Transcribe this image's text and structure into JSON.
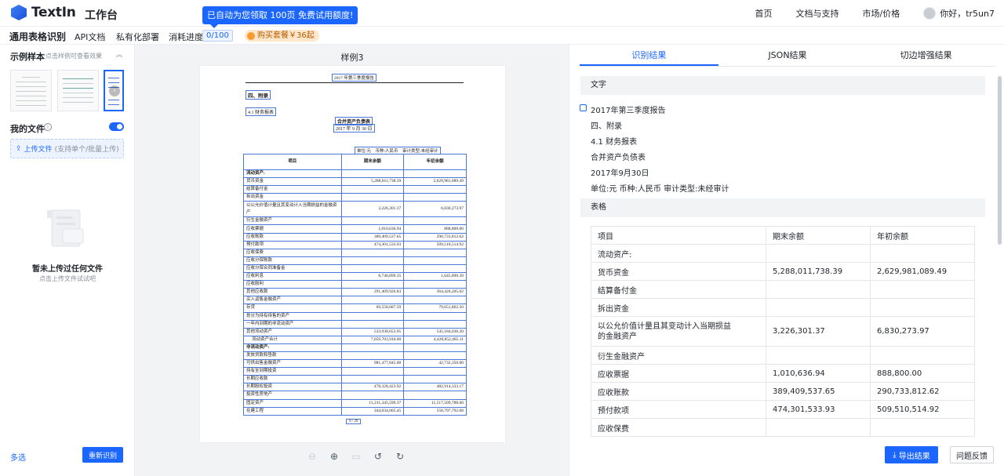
{
  "header": {
    "logo_text": "TextIn",
    "workbench": "工作台",
    "banner": "已自动为您领取 100页 免费试用额度!",
    "nav": [
      "首页",
      "文档与支持",
      "市场/价格"
    ],
    "greeting": "你好，tr5un7"
  },
  "subbar": {
    "title": "通用表格识别",
    "api_docs": "API文档",
    "private_deploy": "私有化部署",
    "usage_label": "消耗进度",
    "usage_value": "0/100",
    "buy_label": "购买套餐￥36起"
  },
  "left": {
    "samples_title": "示例样本",
    "samples_hint": "*点击样例可查看效果",
    "my_files": "我的文件",
    "upload_label": "上传文件",
    "upload_hint": "(支持单个/批量上传)",
    "empty_title": "暂未上传过任何文件",
    "empty_sub": "点击上传文件试试吧",
    "multi_select": "多选",
    "re_recognize": "重新识别"
  },
  "center": {
    "sample_name": "样例3",
    "doc": {
      "report_title": "2017 年第三季度报告",
      "section": "四、附录",
      "subsection": "4.1 财务报表",
      "table_title": "合并资产负债表",
      "date": "2017 年 9 月 30 日",
      "unit_line": "单位:元　币种:人民币　审计类型:未经审计",
      "page_number": "9 / 20",
      "table_header": [
        "项目",
        "期末余额",
        "年初余额"
      ],
      "rows": [
        [
          "流动资产:",
          "",
          ""
        ],
        [
          "货币资金",
          "5,288,011,738.39",
          "2,629,981,089.49"
        ],
        [
          "结算备付金",
          "",
          ""
        ],
        [
          "拆出资金",
          "",
          ""
        ],
        [
          "以公允价值计量且其变动计入当期损益的金融资产",
          "3,226,301.37",
          "6,830,273.97"
        ],
        [
          "衍生金融资产",
          "",
          ""
        ],
        [
          "应收票据",
          "1,010,636.94",
          "888,800.00"
        ],
        [
          "应收账款",
          "389,409,537.65",
          "290,733,812.62"
        ],
        [
          "预付款项",
          "474,301,533.93",
          "509,510,514.92"
        ],
        [
          "应收保费",
          "",
          ""
        ],
        [
          "应收分保账款",
          "",
          ""
        ],
        [
          "应收分保合同准备金",
          "",
          ""
        ],
        [
          "应收利息",
          "8,746,899.35",
          "1,645,890.39"
        ],
        [
          "应收股利",
          "",
          ""
        ],
        [
          "其他应收款",
          "291,409,926.83",
          "364,426,205.02"
        ],
        [
          "买入返售金融资产",
          "",
          ""
        ],
        [
          "存货",
          "69,558,687.59",
          "79,651,862.50"
        ],
        [
          "划分为持有待售的资产",
          "",
          ""
        ],
        [
          "一年内到期的非流动资产",
          "",
          ""
        ],
        [
          "其他流动资产",
          "533,938,653.95",
          "545,184,036.20"
        ],
        [
          "流动资产合计",
          "7,059,703,916.00",
          "4,428,852,485.11"
        ],
        [
          "非流动资产:",
          "",
          ""
        ],
        [
          "发放贷款和垫款",
          "",
          ""
        ],
        [
          "可供出售金融资产",
          "981,477,845.00",
          "42,732,350.00"
        ],
        [
          "持有至到期投资",
          "",
          ""
        ],
        [
          "长期应收款",
          "",
          ""
        ],
        [
          "长期股权投资",
          "478,328,423.92",
          "482,914,333.17"
        ],
        [
          "投资性房地产",
          "",
          ""
        ],
        [
          "固定资产",
          "11,211,345,599.37",
          "11,517,509,788.66"
        ],
        [
          "在建工程",
          "344,034,065.45",
          "558,797,792.68"
        ]
      ]
    }
  },
  "right": {
    "tabs": [
      "识别结果",
      "JSON结果",
      "切边增强结果"
    ],
    "text_section": "文字",
    "text_lines": [
      "2017年第三季度报告",
      "四、附录",
      "4.1 财务报表",
      "合并资产负债表",
      "2017年9月30日",
      "单位:元 币种:人民币 审计类型:未经审计"
    ],
    "table_section": "表格",
    "table_rows": [
      [
        "项目",
        "期末余额",
        "年初余额"
      ],
      [
        "流动资产:",
        "",
        ""
      ],
      [
        "货币资金",
        "5,288,011,738.39",
        "2,629,981,089.49"
      ],
      [
        "结算备付金",
        "",
        ""
      ],
      [
        "拆出资金",
        "",
        ""
      ],
      [
        "以公允价值计量且其变动计入当期损益的金融资产",
        "3,226,301.37",
        "6,830,273.97"
      ],
      [
        "衍生金融资产",
        "",
        ""
      ],
      [
        "应收票据",
        "1,010,636.94",
        "888,800.00"
      ],
      [
        "应收账款",
        "389,409,537.65",
        "290,733,812.62"
      ],
      [
        "预付款项",
        "474,301,533.93",
        "509,510,514.92"
      ],
      [
        "应收保费",
        "",
        ""
      ]
    ],
    "export": "导出结果",
    "feedback": "问题反馈"
  }
}
